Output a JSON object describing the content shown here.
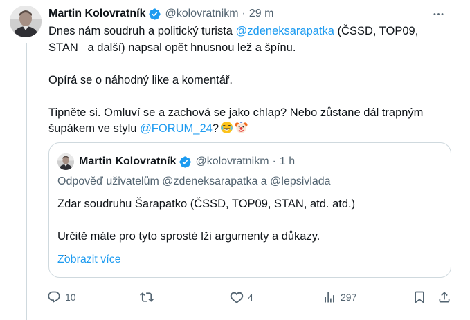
{
  "post": {
    "author_name": "Martin Kolovratník",
    "handle": "@kolovratnikm",
    "separator": "·",
    "time": "29 m",
    "text": {
      "p1_a": "Dnes nám soudruh a politický turista ",
      "p1_mention": "@zdeneksarapatka",
      "p1_b": " (ČSSD, TOP09,\nSTAN   a další) napsal opět hnusnou lež a špínu.",
      "p2": "Opírá se o náhodný like a komentář.",
      "p3_a": "Tipněte si. Omluví se a zachová se jako chlap? Nebo zůstane dál trapným\nšupákem ve stylu ",
      "p3_mention": "@FORUM_24",
      "p3_b": "?"
    },
    "emojis": [
      "face-with-tears-of-joy-emoji",
      "clown-face-emoji"
    ]
  },
  "quote": {
    "author_name": "Martin Kolovratník",
    "handle": "@kolovratnikm",
    "separator": "·",
    "time": "1 h",
    "reply_prefix": "Odpověď uživatelům ",
    "reply_user1": "@zdeneksarapatka",
    "reply_and": " a ",
    "reply_user2": "@lepsivlada",
    "line1": "Zdar soudruhu Šarapatko (ČSSD, TOP09, STAN, atd. atd.)",
    "line2": "Určitě máte pro tyto sprosté lži argumenty a důkazy.",
    "line3": "...",
    "show_more": "Zobrazit více"
  },
  "actions": {
    "replies": "10",
    "reposts": "",
    "likes": "4",
    "views": "297"
  },
  "colors": {
    "link": "#1d9bf0",
    "secondary": "#536471",
    "text": "#0f1419",
    "border": "#cfd9de",
    "verified": "#1d9bf0"
  },
  "icons": {
    "verified": "verified-badge-icon",
    "more": "more-options-icon",
    "reply": "reply-icon",
    "repost": "repost-icon",
    "like": "like-icon",
    "views": "views-icon",
    "bookmark": "bookmark-icon",
    "share": "share-icon"
  }
}
